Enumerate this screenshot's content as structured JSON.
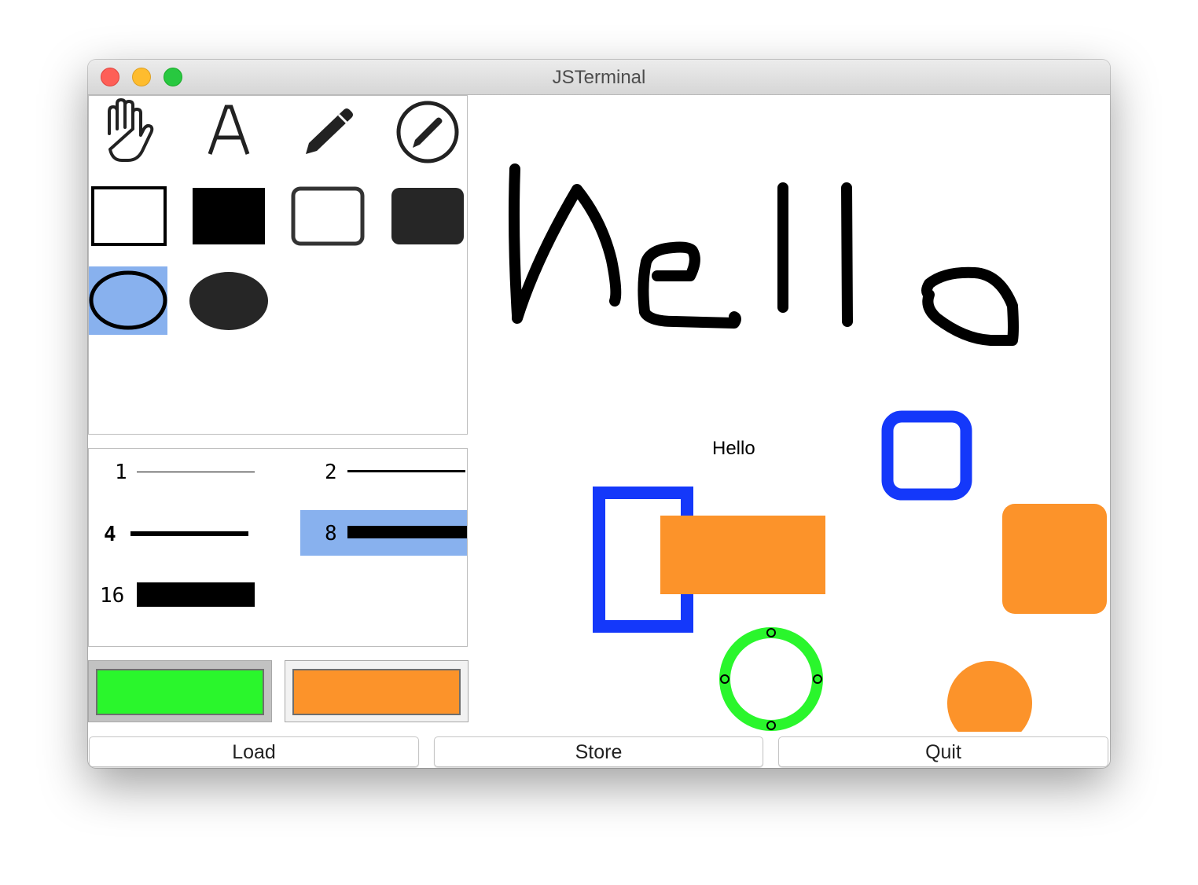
{
  "window": {
    "title": "JSTerminal"
  },
  "tools": [
    {
      "name": "hand-tool"
    },
    {
      "name": "text-tool"
    },
    {
      "name": "pencil-tool"
    },
    {
      "name": "freehand-tool"
    },
    {
      "name": "rect-outline-tool"
    },
    {
      "name": "rect-filled-tool"
    },
    {
      "name": "roundrect-outline-tool"
    },
    {
      "name": "roundrect-filled-tool"
    },
    {
      "name": "ellipse-outline-tool",
      "selected": true
    },
    {
      "name": "ellipse-filled-tool"
    }
  ],
  "line_widths": [
    {
      "label": "1",
      "selected": false
    },
    {
      "label": "2",
      "selected": false
    },
    {
      "label": "4",
      "selected": false
    },
    {
      "label": "8",
      "selected": true
    },
    {
      "label": "16",
      "selected": false
    }
  ],
  "colors": {
    "stroke": "#2af62c",
    "fill": "#fc932a",
    "selection": "#88b1ee",
    "blue_shape": "#1438fa"
  },
  "canvas": {
    "text_object": "Hello",
    "handwriting": "Hello"
  },
  "buttons": {
    "load": "Load",
    "store": "Store",
    "quit": "Quit"
  }
}
